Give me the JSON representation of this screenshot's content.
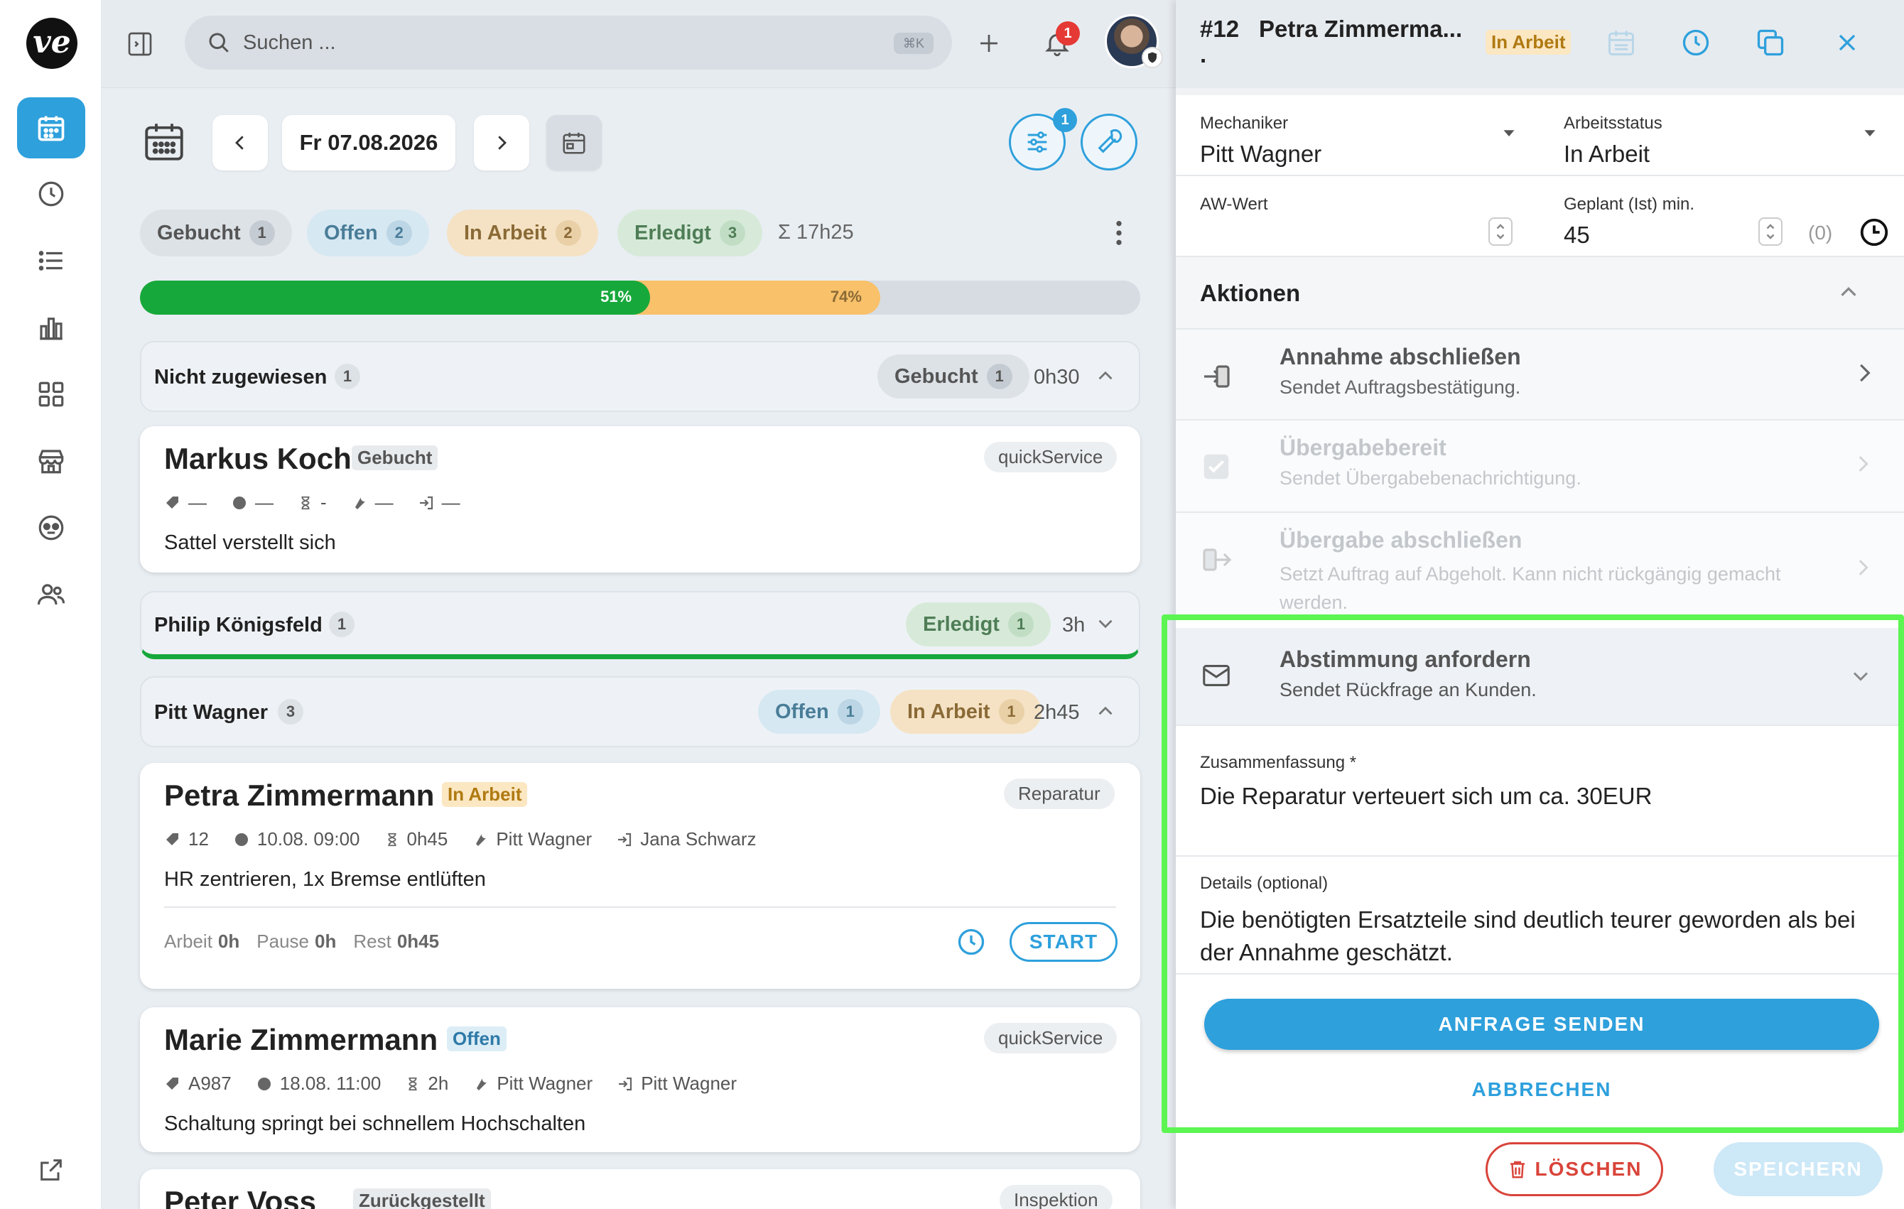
{
  "rail": {
    "logo": "ve",
    "items": [
      {
        "name": "calendar-icon",
        "active": true
      },
      {
        "name": "clock-icon",
        "active": false
      },
      {
        "name": "list-icon",
        "active": false
      },
      {
        "name": "chart-icon",
        "active": false
      },
      {
        "name": "grid-icon",
        "active": false
      },
      {
        "name": "store-icon",
        "active": false
      },
      {
        "name": "support-icon",
        "active": false
      },
      {
        "name": "users-icon",
        "active": false
      }
    ]
  },
  "topbar": {
    "search_placeholder": "Suchen ...",
    "search_shortcut": "⌘K",
    "notification_count": "1"
  },
  "toolbar": {
    "date": "Fr 07.08.2026",
    "filter_count": "1"
  },
  "status_chips": [
    {
      "label": "Gebucht",
      "count": "1"
    },
    {
      "label": "Offen",
      "count": "2"
    },
    {
      "label": "In Arbeit",
      "count": "2"
    },
    {
      "label": "Erledigt",
      "count": "3"
    }
  ],
  "total_time": "Σ 17h25",
  "progress": {
    "done_pct": 51,
    "done_label": "51%",
    "in_progress_pct": 74,
    "in_progress_label": "74%"
  },
  "groups": {
    "unassigned": {
      "title": "Nicht zugewiesen",
      "count": "1",
      "status": "Gebucht",
      "status_count": "1",
      "time": "0h30"
    },
    "philip": {
      "title": "Philip Königsfeld",
      "count": "1",
      "status": "Erledigt",
      "status_count": "1",
      "time": "3h"
    },
    "pitt": {
      "title": "Pitt Wagner",
      "count": "3",
      "status1": "Offen",
      "status1_count": "1",
      "status2": "In Arbeit",
      "status2_count": "1",
      "time": "2h45"
    }
  },
  "cards": {
    "markus": {
      "name": "Markus Koch",
      "badge": "Gebucht",
      "tag": "quickService",
      "m1": "—",
      "m2": "—",
      "m3": "-",
      "m4": "—",
      "m5": "—",
      "desc": "Sattel verstellt sich"
    },
    "petra": {
      "name": "Petra Zimmermann",
      "badge": "In Arbeit",
      "tag": "Reparatur",
      "id": "12",
      "date": "10.08. 09:00",
      "duration": "0h45",
      "mechanic": "Pitt Wagner",
      "customer": "Jana Schwarz",
      "desc": "HR zentrieren, 1x Bremse entlüften",
      "arbeit_label": "Arbeit",
      "arbeit": "0h",
      "pause_label": "Pause",
      "pause": "0h",
      "rest_label": "Rest",
      "rest": "0h45",
      "start": "START"
    },
    "marie": {
      "name": "Marie Zimmermann",
      "badge": "Offen",
      "tag": "quickService",
      "id": "A987",
      "date": "18.08. 11:00",
      "duration": "2h",
      "mechanic": "Pitt Wagner",
      "customer": "Pitt Wagner",
      "desc": "Schaltung springt bei schnellem Hochschalten"
    },
    "peter": {
      "name": "Peter Voss",
      "badge": "Zurückgestellt",
      "tag": "Inspektion"
    }
  },
  "panel": {
    "title_id": "#12",
    "title_name": "Petra Zimmerma...",
    "title_dot": ".",
    "status_badge": "In Arbeit",
    "mechanic_label": "Mechaniker",
    "mechanic_value": "Pitt Wagner",
    "workstatus_label": "Arbeitsstatus",
    "workstatus_value": "In Arbeit",
    "aw_label": "AW-Wert",
    "aw_value": "",
    "planned_label": "Geplant (Ist) min.",
    "planned_value": "45",
    "planned_actual": "(0)",
    "actions_title": "Aktionen",
    "actions": [
      {
        "title": "Annahme abschließen",
        "desc": "Sendet Auftragsbestätigung."
      },
      {
        "title": "Übergabebereit",
        "desc": "Sendet Übergabebenachrichtigung."
      },
      {
        "title": "Übergabe abschließen",
        "desc": "Setzt Auftrag auf Abgeholt. Kann nicht rückgängig gemacht werden."
      }
    ],
    "request": {
      "title": "Abstimmung anfordern",
      "desc": "Sendet Rückfrage an Kunden.",
      "summary_label": "Zusammenfassung *",
      "summary_value": "Die Reparatur verteuert sich um ca. 30EUR",
      "details_label": "Details (optional)",
      "details_value": "Die benötigten Ersatzteile sind deutlich teurer geworden als bei der Annahme geschätzt.",
      "send_label": "ANFRAGE SENDEN",
      "cancel_label": "ABBRECHEN"
    },
    "delete_label": "LÖSCHEN",
    "save_label": "SPEICHERN"
  },
  "colors": {
    "accent": "#2ea0dc",
    "green": "#17a83b",
    "orange": "#f8c16a",
    "highlight": "#5cf552"
  }
}
